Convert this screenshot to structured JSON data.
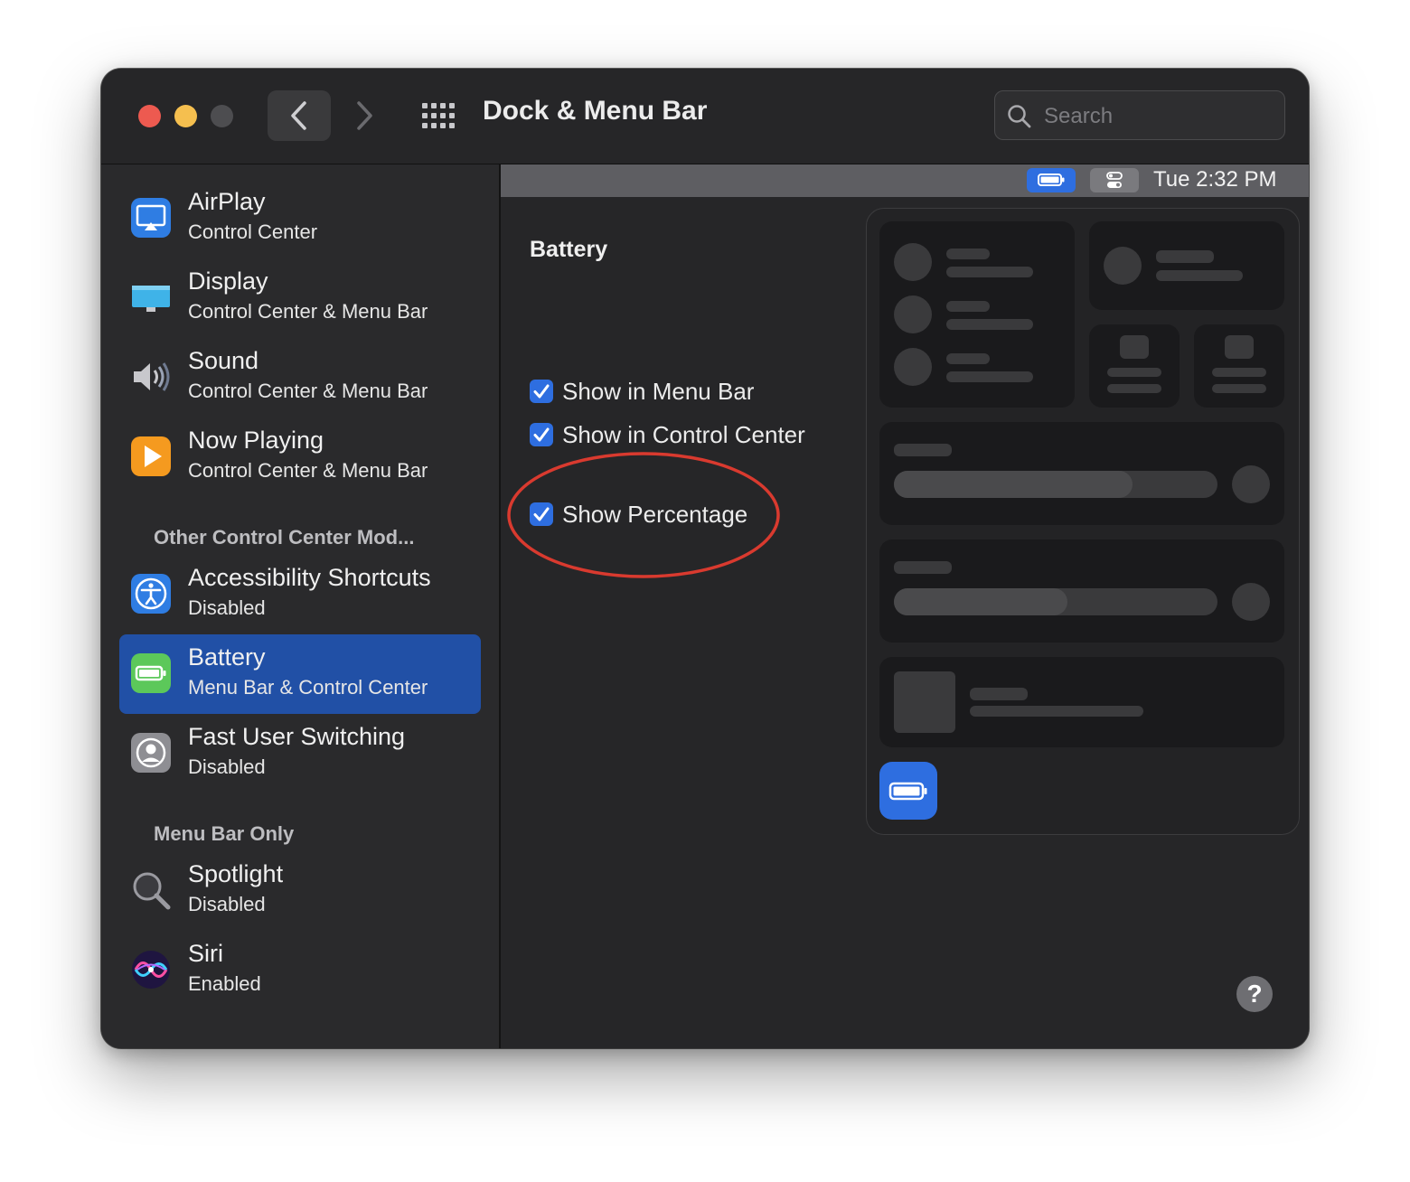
{
  "window": {
    "title": "Dock & Menu Bar"
  },
  "search": {
    "placeholder": "Search"
  },
  "menubar": {
    "clock": "Tue 2:32 PM"
  },
  "sidebar": {
    "items": [
      {
        "name": "AirPlay",
        "sub": "Control Center",
        "icon": "airplay-icon"
      },
      {
        "name": "Display",
        "sub": "Control Center & Menu Bar",
        "icon": "display-icon"
      },
      {
        "name": "Sound",
        "sub": "Control Center & Menu Bar",
        "icon": "speaker-icon"
      },
      {
        "name": "Now Playing",
        "sub": "Control Center & Menu Bar",
        "icon": "play-icon"
      },
      {
        "name": "Accessibility Shortcuts",
        "sub": "Disabled",
        "icon": "accessibility-icon"
      },
      {
        "name": "Battery",
        "sub": "Menu Bar & Control Center",
        "icon": "battery-icon",
        "selected": true
      },
      {
        "name": "Fast User Switching",
        "sub": "Disabled",
        "icon": "user-icon"
      },
      {
        "name": "Spotlight",
        "sub": "Disabled",
        "icon": "magnifier-icon"
      },
      {
        "name": "Siri",
        "sub": "Enabled",
        "icon": "siri-icon"
      }
    ],
    "sections": [
      "Other Control Center Mod...",
      "Menu Bar Only"
    ]
  },
  "battery": {
    "heading": "Battery",
    "options": [
      {
        "label": "Show in Menu Bar",
        "checked": true
      },
      {
        "label": "Show in Control Center",
        "checked": true
      },
      {
        "label": "Show Percentage",
        "checked": true
      }
    ]
  },
  "help": {
    "label": "?"
  },
  "colors": {
    "accent": "#2e6ee0",
    "selection": "#2150a6",
    "annotation": "#d93a2f",
    "close": "#ed5a50",
    "minimize": "#f5bf4f"
  }
}
